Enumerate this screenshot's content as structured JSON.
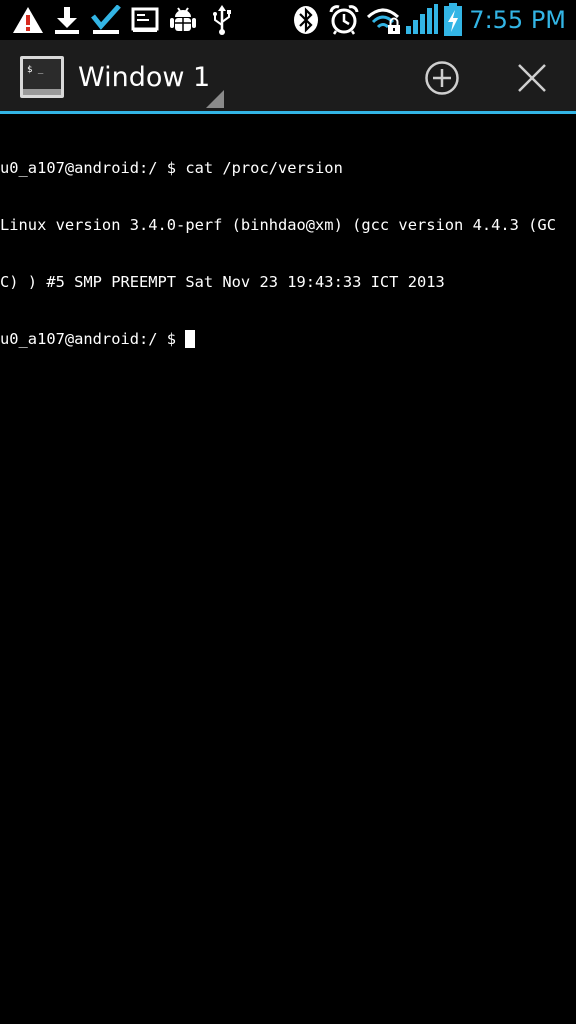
{
  "status_bar": {
    "icons": [
      "warning-icon",
      "download-icon",
      "check-icon",
      "screen-icon",
      "android-debug-icon",
      "usb-icon",
      "bluetooth-icon",
      "alarm-icon",
      "wifi-icon",
      "signal-icon",
      "battery-charging-icon"
    ],
    "time": "7:55 PM",
    "accent_color": "#33b5e5"
  },
  "action_bar": {
    "app_icon": "terminal-app-icon",
    "window_title": "Window 1",
    "add_icon": "add-circle-icon",
    "close_icon": "close-icon",
    "accent_color": "#33b5e5"
  },
  "terminal": {
    "lines": [
      "u0_a107@android:/ $ cat /proc/version",
      "Linux version 3.4.0-perf (binhdao@xm) (gcc version 4.4.3 (GC",
      "C) ) #5 SMP PREEMPT Sat Nov 23 19:43:33 ICT 2013",
      "u0_a107@android:/ $ "
    ],
    "cursor_visible": true
  }
}
